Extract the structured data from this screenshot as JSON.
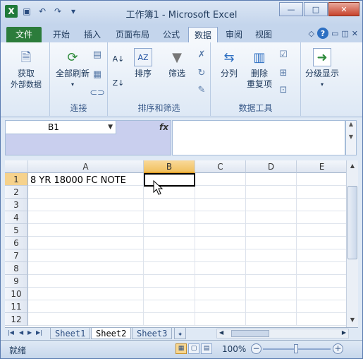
{
  "app": {
    "title": "工作簿1 - Microsoft Excel",
    "logo": "X"
  },
  "window_controls": {
    "minimize": "—",
    "maximize": "□",
    "close": "✕"
  },
  "ribbon_tabs": [
    {
      "label": "文件"
    },
    {
      "label": "开始"
    },
    {
      "label": "插入"
    },
    {
      "label": "页面布局"
    },
    {
      "label": "公式"
    },
    {
      "label": "数据"
    },
    {
      "label": "审阅"
    },
    {
      "label": "视图"
    }
  ],
  "active_tab": "数据",
  "ribbon": {
    "get_external": "获取\n外部数据",
    "get_external_l1": "获取",
    "get_external_l2": "外部数据",
    "refresh_all": "全部刷新",
    "group_connections": "连接",
    "sort": "排序",
    "filter": "筛选",
    "group_sort_filter": "排序和筛选",
    "text_to_columns": "分列",
    "remove_dup_l1": "删除",
    "remove_dup_l2": "重复项",
    "group_data_tools": "数据工具",
    "outline": "分级显示"
  },
  "formula_bar": {
    "name_box": "B1",
    "fx_label": "fx",
    "formula": ""
  },
  "columns": [
    "A",
    "B",
    "C",
    "D",
    "E"
  ],
  "selected_column": "B",
  "rows": [
    "1",
    "2",
    "3",
    "4",
    "5",
    "6",
    "7",
    "8",
    "9",
    "10",
    "11",
    "12"
  ],
  "selected_row": "1",
  "cells": {
    "A1": "8 YR 18000 FC NOTE"
  },
  "sheets": [
    "Sheet1",
    "Sheet2",
    "Sheet3"
  ],
  "active_sheet": "Sheet2",
  "status": {
    "ready": "就绪",
    "zoom": "100%"
  }
}
